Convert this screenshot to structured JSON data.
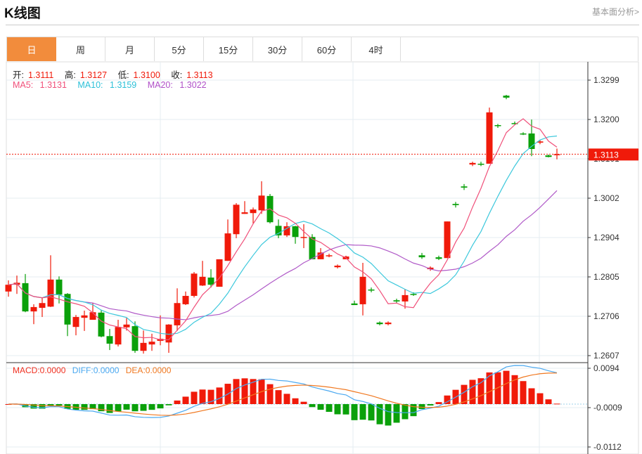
{
  "header": {
    "title": "K线图",
    "link": "基本面分析>"
  },
  "tabs": [
    {
      "label": "日",
      "active": true
    },
    {
      "label": "周"
    },
    {
      "label": "月"
    },
    {
      "label": "5分"
    },
    {
      "label": "15分"
    },
    {
      "label": "30分"
    },
    {
      "label": "60分"
    },
    {
      "label": "4时"
    }
  ],
  "ohlc": {
    "open_label": "开:",
    "open": "1.3111",
    "high_label": "高:",
    "high": "1.3127",
    "low_label": "低:",
    "low": "1.3100",
    "close_label": "收:",
    "close": "1.3113"
  },
  "ma": {
    "ma5_label": "MA5:",
    "ma5": "1.3131",
    "ma10_label": "MA10:",
    "ma10": "1.3159",
    "ma20_label": "MA20:",
    "ma20": "1.3022"
  },
  "macd_info": {
    "macd": "MACD:0.0000",
    "diff": "DIFF:0.0000",
    "dea": "DEA:0.0000"
  },
  "price_axis": [
    "1.3299",
    "1.3200",
    "1.3101",
    "1.3002",
    "1.2904",
    "1.2805",
    "1.2706",
    "1.2607"
  ],
  "macd_axis": [
    "0.0094",
    "-0.0009",
    "-0.0112"
  ],
  "current_price": "1.3113",
  "colors": {
    "up": "#f01a0a",
    "down": "#0aa00a",
    "ma5": "#f0507a",
    "ma10": "#3cc8dc",
    "ma20": "#b05ac8",
    "diff": "#4aa8f0",
    "dea": "#f07820",
    "tab_active": "#f28c3c"
  },
  "chart_data": {
    "type": "candlestick",
    "ylim": [
      1.2607,
      1.3299
    ],
    "candles": [
      [
        1.2768,
        1.2796,
        1.2755,
        1.2785
      ],
      [
        1.2785,
        1.2808,
        1.2762,
        1.279
      ],
      [
        1.2789,
        1.2812,
        1.2716,
        1.2718
      ],
      [
        1.2718,
        1.2736,
        1.2686,
        1.2729
      ],
      [
        1.2727,
        1.2753,
        1.2704,
        1.2739
      ],
      [
        1.273,
        1.2859,
        1.2729,
        1.2798
      ],
      [
        1.2798,
        1.2806,
        1.2738,
        1.276
      ],
      [
        1.2762,
        1.2764,
        1.2656,
        1.2685
      ],
      [
        1.2679,
        1.2709,
        1.2658,
        1.2704
      ],
      [
        1.2702,
        1.272,
        1.2669,
        1.2708
      ],
      [
        1.2697,
        1.2739,
        1.2697,
        1.2716
      ],
      [
        1.2715,
        1.2722,
        1.2653,
        1.2655
      ],
      [
        1.2656,
        1.2674,
        1.2621,
        1.2637
      ],
      [
        1.2635,
        1.2697,
        1.263,
        1.2679
      ],
      [
        1.2678,
        1.2702,
        1.267,
        1.2685
      ],
      [
        1.2681,
        1.2693,
        1.2614,
        1.2619
      ],
      [
        1.2619,
        1.267,
        1.2612,
        1.2639
      ],
      [
        1.2635,
        1.2662,
        1.2619,
        1.2642
      ],
      [
        1.2644,
        1.2708,
        1.2633,
        1.2649
      ],
      [
        1.264,
        1.2686,
        1.2614,
        1.2685
      ],
      [
        1.2683,
        1.2776,
        1.2669,
        1.2739
      ],
      [
        1.2736,
        1.2768,
        1.2734,
        1.2757
      ],
      [
        1.2757,
        1.2817,
        1.2753,
        1.2813
      ],
      [
        1.2783,
        1.2845,
        1.2782,
        1.2805
      ],
      [
        1.2803,
        1.2824,
        1.2778,
        1.2785
      ],
      [
        1.278,
        1.2849,
        1.278,
        1.2849
      ],
      [
        1.2845,
        1.2949,
        1.2845,
        1.2914
      ],
      [
        1.2912,
        1.299,
        1.2902,
        1.2986
      ],
      [
        1.2963,
        1.2995,
        1.2963,
        1.2967
      ],
      [
        1.2965,
        1.2979,
        1.2939,
        1.2974
      ],
      [
        1.2972,
        1.3045,
        1.2963,
        1.3009
      ],
      [
        1.3008,
        1.3013,
        1.2939,
        1.2942
      ],
      [
        1.2933,
        1.2949,
        1.2902,
        1.2909
      ],
      [
        1.2909,
        1.2942,
        1.2905,
        1.2932
      ],
      [
        1.2932,
        1.2933,
        1.2888,
        1.2905
      ],
      [
        1.2903,
        1.2937,
        1.2877,
        1.2905
      ],
      [
        1.2905,
        1.2912,
        1.2849,
        1.2849
      ],
      [
        1.2849,
        1.2877,
        1.2849,
        1.2866
      ],
      [
        1.2858,
        1.2863,
        1.2854,
        1.2859
      ],
      [
        1.2829,
        1.2836,
        1.2826,
        1.2833
      ],
      [
        1.2849,
        1.2858,
        1.2849,
        1.2856
      ],
      [
        1.2738,
        1.2745,
        1.2734,
        1.2734
      ],
      [
        1.2736,
        1.284,
        1.2708,
        1.2805
      ],
      [
        1.2773,
        1.2778,
        1.2766,
        1.2771
      ],
      [
        1.269,
        1.2693,
        1.2683,
        1.2686
      ],
      [
        1.2686,
        1.2693,
        1.2683,
        1.269
      ],
      [
        1.2746,
        1.275,
        1.2739,
        1.2743
      ],
      [
        1.2743,
        1.2773,
        1.2725,
        1.2759
      ],
      [
        1.2762,
        1.2766,
        1.2757,
        1.276
      ],
      [
        1.2859,
        1.2865,
        1.285,
        1.2854
      ],
      [
        1.2824,
        1.2831,
        1.282,
        1.2828
      ],
      [
        1.2854,
        1.2858,
        1.2847,
        1.285
      ],
      [
        1.2852,
        1.2944,
        1.2852,
        1.2944
      ],
      [
        1.2988,
        1.2993,
        1.2979,
        1.2985
      ],
      [
        1.3032,
        1.3038,
        1.3023,
        1.3029
      ],
      [
        1.3087,
        1.3094,
        1.3083,
        1.3091
      ],
      [
        1.3089,
        1.3094,
        1.3083,
        1.3087
      ],
      [
        1.3089,
        1.323,
        1.3089,
        1.3218
      ],
      [
        1.3186,
        1.3189,
        1.3179,
        1.3184
      ],
      [
        1.326,
        1.3262,
        1.3251,
        1.3255
      ],
      [
        1.3191,
        1.3195,
        1.3188,
        1.3189
      ],
      [
        1.3165,
        1.3168,
        1.3161,
        1.3163
      ],
      [
        1.3165,
        1.32,
        1.3108,
        1.3126
      ],
      [
        1.3142,
        1.3149,
        1.3138,
        1.3145
      ],
      [
        1.311,
        1.3112,
        1.3105,
        1.3106
      ],
      [
        1.3111,
        1.3127,
        1.31,
        1.3113
      ]
    ]
  }
}
